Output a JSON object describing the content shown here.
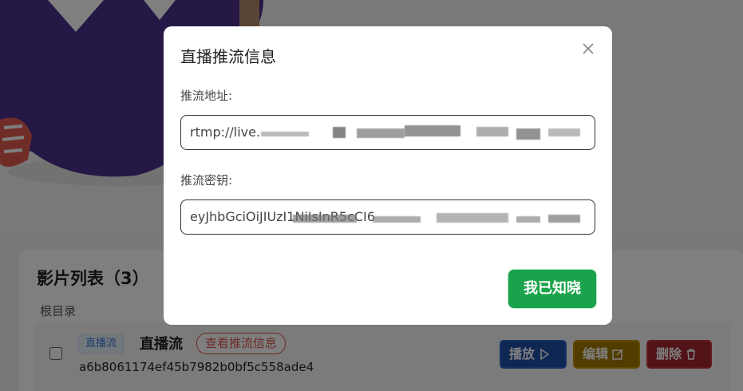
{
  "dialog": {
    "title": "直播推流信息",
    "push_url_label": "推流地址:",
    "push_url_value": "rtmp://live.",
    "push_key_label": "推流密钥:",
    "push_key_value": "eyJhbGciOiJIUzI1NiIsInR5cCI6",
    "confirm_button": "我已知晓"
  },
  "list": {
    "title": "影片列表（3）",
    "breadcrumb": "根目录",
    "items": [
      {
        "tag": "直播流",
        "name": "直播流",
        "view_info": "查看推流信息",
        "id": "a6b8061174ef45b7982b0bf5c558ade4"
      }
    ],
    "actions": {
      "play": "播放",
      "edit": "编辑",
      "delete": "删除"
    }
  },
  "colors": {
    "overlay": "#000000",
    "primary_ok": "#1aa34a",
    "play": "#2b62c8",
    "edit": "#c59200",
    "delete": "#c4323b",
    "tag": "#3d7fd6",
    "danger_link": "#d9534f"
  }
}
